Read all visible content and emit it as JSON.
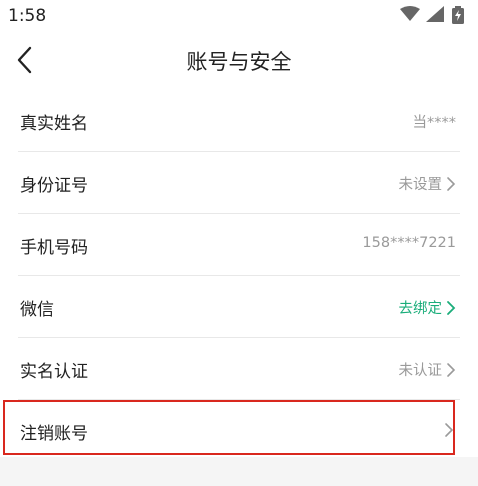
{
  "status": {
    "time": "1:58",
    "icons": [
      "wifi-icon",
      "cell-signal-icon",
      "battery-charging-icon"
    ]
  },
  "header": {
    "title": "账号与安全",
    "back_icon": "back-arrow-icon"
  },
  "items": [
    {
      "label": "真实姓名",
      "value": "当****",
      "chevron": false
    },
    {
      "label": "身份证号",
      "value": "未设置",
      "chevron": true
    },
    {
      "label": "手机号码",
      "value": "158****7221",
      "chevron": false
    },
    {
      "label": "微信",
      "value": "去绑定",
      "chevron": true,
      "value_color": "#1aad7a"
    },
    {
      "label": "实名认证",
      "value": "未认证",
      "chevron": true
    },
    {
      "label": "注销账号",
      "value": "",
      "chevron": true,
      "highlighted": true
    }
  ],
  "colors": {
    "accent": "#1aad7a",
    "highlight_border": "#d9281e"
  }
}
